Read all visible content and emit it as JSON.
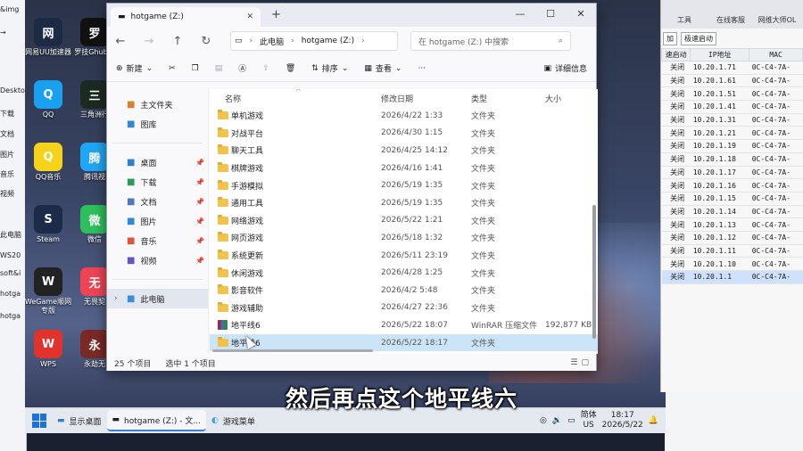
{
  "left_strip": {
    "items": [
      "&img",
      "→",
      "Deskto",
      "下载",
      "文档",
      "图片",
      "音乐",
      "视频",
      "此电脑",
      "WS20",
      "soft&i",
      "hotga",
      "hotga"
    ]
  },
  "desktop": {
    "icons": [
      {
        "label": "网易UU加速器",
        "icon": "uu-icon",
        "color": "#1d2a44"
      },
      {
        "label": "罗技Ghub设",
        "icon": "ghub-icon",
        "color": "#111111"
      },
      {
        "label": "QQ",
        "icon": "qq-icon",
        "color": "#1aa0f0"
      },
      {
        "label": "三角洲行",
        "icon": "delta-icon",
        "color": "#1c2b22"
      },
      {
        "label": "QQ音乐",
        "icon": "qqmusic-icon",
        "color": "#f7d21b"
      },
      {
        "label": "腾讯视",
        "icon": "tencent-video-icon",
        "color": "#1fa6f5"
      },
      {
        "label": "Steam",
        "icon": "steam-icon",
        "color": "#1b2b48"
      },
      {
        "label": "微信",
        "icon": "wechat-icon",
        "color": "#2ec05c"
      },
      {
        "label": "WeGame顺网专版",
        "icon": "wegame-icon",
        "color": "#222222"
      },
      {
        "label": "无畏契",
        "icon": "valorant-icon",
        "color": "#f04454"
      },
      {
        "label": "WPS",
        "icon": "wps-icon",
        "color": "#e2322c"
      },
      {
        "label": "永劫无",
        "icon": "naraka-icon",
        "color": "#7a2a26"
      }
    ]
  },
  "bg_app": {
    "top_tabs": [
      "工具",
      "在线客服",
      "网维大师OL"
    ],
    "buttons": [
      "加",
      "极速启动"
    ],
    "columns": [
      "速启动",
      "IP地址",
      "MAC"
    ],
    "rows": [
      {
        "status": "关闭",
        "ip": "10.20.1.71",
        "mac": "0C-C4-7A-"
      },
      {
        "status": "关闭",
        "ip": "10.20.1.61",
        "mac": "0C-C4-7A-"
      },
      {
        "status": "关闭",
        "ip": "10.20.1.51",
        "mac": "0C-C4-7A-"
      },
      {
        "status": "关闭",
        "ip": "10.20.1.41",
        "mac": "0C-C4-7A-"
      },
      {
        "status": "关闭",
        "ip": "10.20.1.31",
        "mac": "0C-C4-7A-"
      },
      {
        "status": "关闭",
        "ip": "10.20.1.21",
        "mac": "0C-C4-7A-"
      },
      {
        "status": "关闭",
        "ip": "10.20.1.19",
        "mac": "0C-C4-7A-"
      },
      {
        "status": "关闭",
        "ip": "10.20.1.18",
        "mac": "0C-C4-7A-"
      },
      {
        "status": "关闭",
        "ip": "10.20.1.17",
        "mac": "0C-C4-7A-"
      },
      {
        "status": "关闭",
        "ip": "10.20.1.16",
        "mac": "0C-C4-7A-"
      },
      {
        "status": "关闭",
        "ip": "10.20.1.15",
        "mac": "0C-C4-7A-"
      },
      {
        "status": "关闭",
        "ip": "10.20.1.14",
        "mac": "0C-C4-7A-"
      },
      {
        "status": "关闭",
        "ip": "10.20.1.13",
        "mac": "0C-C4-7A-"
      },
      {
        "status": "关闭",
        "ip": "10.20.1.12",
        "mac": "0C-C4-7A-"
      },
      {
        "status": "关闭",
        "ip": "10.20.1.11",
        "mac": "0C-C4-7A-"
      },
      {
        "status": "关闭",
        "ip": "10.20.1.10",
        "mac": "0C-C4-7A-"
      },
      {
        "status": "关闭",
        "ip": "10.20.1.1",
        "mac": "0C-C4-7A-",
        "selected": true
      }
    ]
  },
  "explorer": {
    "tab_title": "hotgame (Z:)",
    "breadcrumb": [
      "此电脑",
      "hotgame (Z:)"
    ],
    "search_placeholder": "在 hotgame (Z:) 中搜索",
    "commands": {
      "new": "新建",
      "sort": "排序",
      "view": "查看",
      "more": "···",
      "details": "详细信息"
    },
    "nav_items": [
      {
        "label": "主文件夹",
        "icon": "home-icon",
        "color": "#d9822b"
      },
      {
        "label": "图库",
        "icon": "gallery-icon",
        "color": "#2f87d6"
      },
      {
        "label": "桌面",
        "icon": "desktop-icon",
        "color": "#2f7fd1",
        "pin": true
      },
      {
        "label": "下载",
        "icon": "download-icon",
        "color": "#2c9a55",
        "pin": true
      },
      {
        "label": "文档",
        "icon": "documents-icon",
        "color": "#4a78c2",
        "pin": true
      },
      {
        "label": "图片",
        "icon": "pictures-icon",
        "color": "#2f87d6",
        "pin": true
      },
      {
        "label": "音乐",
        "icon": "music-icon",
        "color": "#e0543a",
        "pin": true
      },
      {
        "label": "视频",
        "icon": "videos-icon",
        "color": "#6b52c4",
        "pin": true
      },
      {
        "label": "此电脑",
        "icon": "this-pc-icon",
        "color": "#3b8fd6",
        "selected": true
      }
    ],
    "columns": {
      "name": "名称",
      "date": "修改日期",
      "type": "类型",
      "size": "大小"
    },
    "files": [
      {
        "name": "单机游戏",
        "date": "2026/4/22 1:33",
        "type": "文件夹",
        "size": ""
      },
      {
        "name": "对战平台",
        "date": "2026/4/30 1:15",
        "type": "文件夹",
        "size": ""
      },
      {
        "name": "聊天工具",
        "date": "2026/4/25 14:12",
        "type": "文件夹",
        "size": ""
      },
      {
        "name": "棋牌游戏",
        "date": "2026/4/16 1:41",
        "type": "文件夹",
        "size": ""
      },
      {
        "name": "手游模拟",
        "date": "2026/5/19 1:35",
        "type": "文件夹",
        "size": ""
      },
      {
        "name": "通用工具",
        "date": "2026/5/19 1:35",
        "type": "文件夹",
        "size": ""
      },
      {
        "name": "网络游戏",
        "date": "2026/5/22 1:21",
        "type": "文件夹",
        "size": ""
      },
      {
        "name": "网页游戏",
        "date": "2026/5/18 1:32",
        "type": "文件夹",
        "size": ""
      },
      {
        "name": "系统更新",
        "date": "2026/5/11 23:19",
        "type": "文件夹",
        "size": ""
      },
      {
        "name": "休闲游戏",
        "date": "2026/4/28 1:25",
        "type": "文件夹",
        "size": ""
      },
      {
        "name": "影音软件",
        "date": "2026/4/2 5:48",
        "type": "文件夹",
        "size": ""
      },
      {
        "name": "游戏辅助",
        "date": "2026/4/27 22:36",
        "type": "文件夹",
        "size": ""
      },
      {
        "name": "地平线6",
        "date": "2026/5/22 18:07",
        "type": "WinRAR 压缩文件",
        "size": "192,877 KB",
        "kind": "rar"
      },
      {
        "name": "地平线6",
        "date": "2026/5/22 18:17",
        "type": "文件夹",
        "size": "",
        "selected": true
      }
    ],
    "status": {
      "count": "25 个项目",
      "selection": "选中 1 个项目"
    }
  },
  "taskbar": {
    "show_desktop": "显示桌面",
    "explorer_task": "hotgame (Z:) - 文...",
    "game_menu": "游戏菜单",
    "ime_lang": "简体",
    "ime_layout": "US",
    "time": "18:17",
    "date": "2026/5/22"
  },
  "subtitle": "然后再点这个地平线六"
}
